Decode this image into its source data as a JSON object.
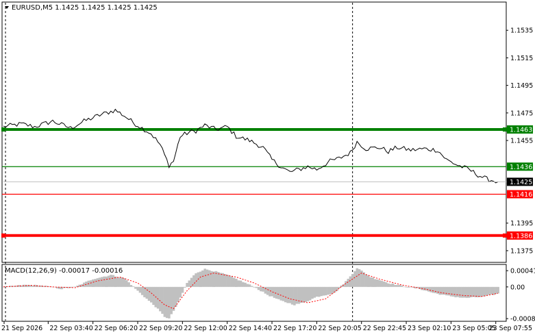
{
  "header": {
    "symbol_text": "EURUSD,M5  1.1425 1.1425 1.1425 1.1425"
  },
  "macd_header": {
    "text": "MACD(12,26,9) -0.00017 -0.00016"
  },
  "colors": {
    "background": "#ffffff",
    "price_line": "#000000",
    "green_level": "#008000",
    "red_level": "#ff0000",
    "current_price_bg": "#000000",
    "macd_histogram": "#c0c0c0",
    "macd_signal": "#ff0000",
    "grid_vertical": "#000000"
  },
  "chart_data": [
    {
      "type": "line",
      "title": "EURUSD,M5",
      "series": [
        {
          "name": "",
          "values_note_seed": "generated from key points"
        }
      ],
      "ylim": [
        1.1367,
        1.1555
      ],
      "y_ticks": [
        "1.1535",
        "1.1515",
        "1.1495",
        "1.1475",
        "1.1455",
        "1.1395",
        "1.1375"
      ],
      "y_tick_values": [
        1.1535,
        1.1515,
        1.1495,
        1.1475,
        1.1455,
        1.1395,
        1.1375
      ],
      "x_ticks": [
        "21 Sep 2026",
        "22 Sep 03:40",
        "22 Sep 06:20",
        "22 Sep 09:20",
        "22 Sep 12:00",
        "22 Sep 14:40",
        "22 Sep 17:20",
        "22 Sep 20:05",
        "22 Sep 22:45",
        "23 Sep 02:10",
        "23 Sep 05:05",
        "23 Sep 07:55"
      ],
      "x_tick_index": [
        0,
        20,
        40,
        60,
        80,
        100,
        120,
        140,
        160,
        180,
        200,
        220
      ],
      "x_count": 222,
      "key_points": [
        [
          0,
          1.1465
        ],
        [
          8,
          1.1467
        ],
        [
          14,
          1.1465
        ],
        [
          22,
          1.1469
        ],
        [
          30,
          1.1464
        ],
        [
          36,
          1.1469
        ],
        [
          44,
          1.1474
        ],
        [
          50,
          1.1477
        ],
        [
          54,
          1.1473
        ],
        [
          58,
          1.1468
        ],
        [
          62,
          1.1464
        ],
        [
          66,
          1.146
        ],
        [
          70,
          1.1452
        ],
        [
          74,
          1.1437
        ],
        [
          76,
          1.144
        ],
        [
          79,
          1.1458
        ],
        [
          83,
          1.1461
        ],
        [
          86,
          1.1462
        ],
        [
          90,
          1.1466
        ],
        [
          95,
          1.1463
        ],
        [
          100,
          1.1465
        ],
        [
          104,
          1.1458
        ],
        [
          110,
          1.1455
        ],
        [
          116,
          1.145
        ],
        [
          120,
          1.1441
        ],
        [
          124,
          1.1436
        ],
        [
          128,
          1.1432
        ],
        [
          132,
          1.1434
        ],
        [
          136,
          1.1436
        ],
        [
          140,
          1.1434
        ],
        [
          146,
          1.144
        ],
        [
          150,
          1.1442
        ],
        [
          155,
          1.1446
        ],
        [
          158,
          1.1454
        ],
        [
          162,
          1.1449
        ],
        [
          168,
          1.145
        ],
        [
          172,
          1.1447
        ],
        [
          176,
          1.145
        ],
        [
          182,
          1.1448
        ],
        [
          188,
          1.1449
        ],
        [
          194,
          1.1448
        ],
        [
          198,
          1.1441
        ],
        [
          203,
          1.1437
        ],
        [
          208,
          1.1434
        ],
        [
          212,
          1.143
        ],
        [
          216,
          1.1427
        ],
        [
          221,
          1.1425
        ]
      ],
      "current_price": 1.1425,
      "current_price_label": "1.1425",
      "levels": [
        {
          "value": 1.1463,
          "label": "1.1463",
          "color": "#008000",
          "style": "thick"
        },
        {
          "value": 1.1436,
          "label": "1.1436",
          "color": "#008000",
          "style": "thin"
        },
        {
          "value": 1.1416,
          "label": "1.1416",
          "color": "#ff0000",
          "style": "thin"
        },
        {
          "value": 1.1386,
          "label": "1.1386",
          "color": "#ff0000",
          "style": "thick"
        }
      ],
      "vertical_dashed_at_index": [
        0,
        156
      ]
    },
    {
      "type": "bar",
      "title": "MACD(12,26,9) -0.00017 -0.00016",
      "series": [
        {
          "name": "",
          "kind": "histogram"
        },
        {
          "name": "",
          "kind": "signal"
        }
      ],
      "ylim": [
        -0.00085,
        0.00055
      ],
      "y_ticks": [
        "0.00041",
        "0.00",
        "-0.0008"
      ],
      "y_tick_values": [
        0.00041,
        0.0,
        -0.0008
      ],
      "hist_key_points": [
        [
          0,
          0.0
        ],
        [
          10,
          5e-05
        ],
        [
          18,
          3e-05
        ],
        [
          26,
          -5e-05
        ],
        [
          32,
          0.0
        ],
        [
          40,
          0.0002
        ],
        [
          48,
          0.0003
        ],
        [
          54,
          0.00022
        ],
        [
          60,
          -0.0001
        ],
        [
          64,
          -0.0003
        ],
        [
          68,
          -0.0005
        ],
        [
          72,
          -0.00075
        ],
        [
          74,
          -0.0008
        ],
        [
          78,
          -0.0004
        ],
        [
          82,
          0.0001
        ],
        [
          86,
          0.00035
        ],
        [
          90,
          0.00045
        ],
        [
          94,
          0.0004
        ],
        [
          100,
          0.0003
        ],
        [
          106,
          0.00015
        ],
        [
          112,
          0.0
        ],
        [
          118,
          -0.0002
        ],
        [
          124,
          -0.00035
        ],
        [
          130,
          -0.00045
        ],
        [
          134,
          -0.0004
        ],
        [
          140,
          -0.00025
        ],
        [
          148,
          -0.00015
        ],
        [
          154,
          0.0002
        ],
        [
          158,
          0.00048
        ],
        [
          164,
          0.00025
        ],
        [
          172,
          0.0001
        ],
        [
          180,
          0.0
        ],
        [
          186,
          -5e-05
        ],
        [
          192,
          -0.00015
        ],
        [
          198,
          -0.00022
        ],
        [
          206,
          -0.00028
        ],
        [
          214,
          -0.00025
        ],
        [
          221,
          -0.00017
        ]
      ],
      "signal_key_points": [
        [
          0,
          0.0
        ],
        [
          12,
          4e-05
        ],
        [
          22,
          0.0
        ],
        [
          32,
          -2e-05
        ],
        [
          42,
          0.00015
        ],
        [
          52,
          0.00025
        ],
        [
          60,
          0.0001
        ],
        [
          66,
          -0.00015
        ],
        [
          72,
          -0.00045
        ],
        [
          76,
          -0.00055
        ],
        [
          82,
          -0.0001
        ],
        [
          88,
          0.00025
        ],
        [
          94,
          0.00035
        ],
        [
          104,
          0.00025
        ],
        [
          112,
          0.0001
        ],
        [
          120,
          -0.00012
        ],
        [
          128,
          -0.0003
        ],
        [
          136,
          -0.0004
        ],
        [
          144,
          -0.0003
        ],
        [
          152,
          5e-05
        ],
        [
          160,
          0.00035
        ],
        [
          168,
          0.0002
        ],
        [
          178,
          5e-05
        ],
        [
          188,
          -5e-05
        ],
        [
          196,
          -0.00015
        ],
        [
          206,
          -0.00022
        ],
        [
          214,
          -0.00024
        ],
        [
          221,
          -0.00016
        ]
      ]
    }
  ]
}
